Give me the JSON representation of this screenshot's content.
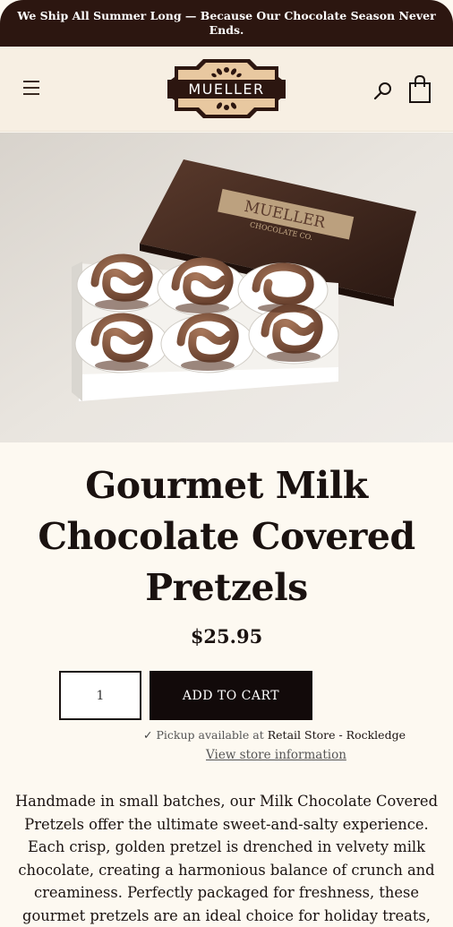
{
  "announcement": {
    "text": "We Ship All Summer Long — Because Our Chocolate Season Never Ends."
  },
  "header": {
    "logo_text": "MUELLER",
    "icons": {
      "menu": "hamburger-menu-icon",
      "search": "search-icon",
      "cart": "shopping-bag-icon"
    }
  },
  "hero": {
    "box_lid_text": "MUELLER",
    "box_lid_subtext": "CHOCOLATE CO."
  },
  "product": {
    "title": "Gourmet Milk Chocolate Covered Pretzels",
    "price": "$25.95",
    "quantity": "1",
    "add_to_cart_label": "ADD TO CART",
    "pickup_prefix": "Pickup available at",
    "pickup_store": "Retail Store - Rockledge",
    "store_info_link": "View store information",
    "description": "Handmade in small batches, our Milk Chocolate Covered Pretzels offer the ultimate sweet-and-salty experience. Each crisp, golden pretzel is drenched in velvety milk chocolate, creating a harmonious balance of crunch and creaminess. Perfectly packaged for freshness, these gourmet pretzels are an ideal choice for holiday treats,"
  },
  "colors": {
    "announcement_bg": "#2c1610",
    "header_bg": "#f7efe3",
    "page_bg": "#fdf9f1",
    "button_bg": "#120a0a",
    "logo_brown": "#2c1610",
    "logo_tan": "#e8c8a0"
  }
}
